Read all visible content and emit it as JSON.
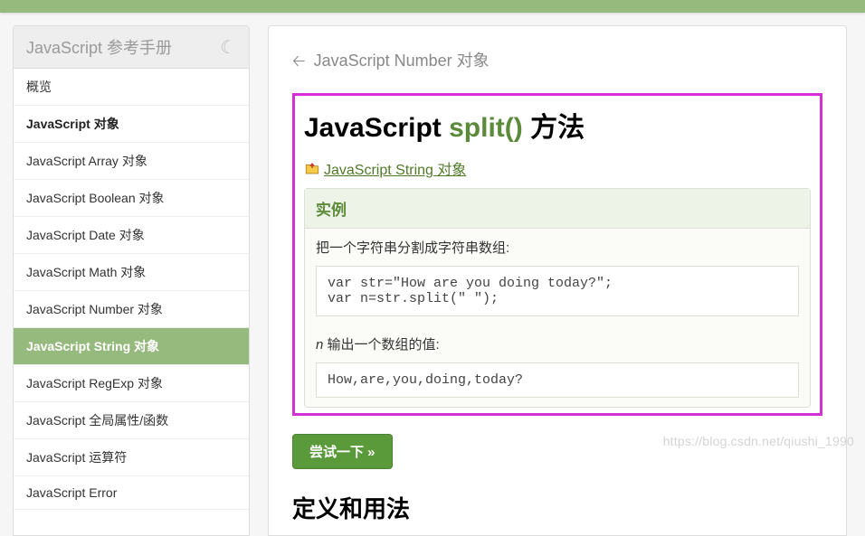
{
  "sidebar": {
    "header": "JavaScript 参考手册",
    "overview": "概览",
    "heading": "JavaScript 对象",
    "items": [
      "JavaScript Array 对象",
      "JavaScript Boolean 对象",
      "JavaScript Date 对象",
      "JavaScript Math 对象",
      "JavaScript Number 对象",
      "JavaScript String 对象",
      "JavaScript RegExp 对象",
      "JavaScript 全局属性/函数",
      "JavaScript 运算符",
      "JavaScript Error"
    ],
    "active_index": 5
  },
  "breadcrumb": {
    "back_label": "JavaScript Number 对象"
  },
  "page": {
    "title_prefix": "JavaScript",
    "title_method": "split()",
    "title_suffix": "方法",
    "parent_link": "JavaScript String 对象",
    "section_def": "定义和用法"
  },
  "example": {
    "header": "实例",
    "desc1": "把一个字符串分割成字符串数组:",
    "code1": "var str=\"How are you doing today?\";\nvar n=str.split(\" \");",
    "desc2_prefix": "n",
    "desc2_rest": " 输出一个数组的值:",
    "code2": "How,are,you,doing,today?",
    "try_label": "尝试一下 »"
  },
  "watermark": "https://blog.csdn.net/qiushi_1990"
}
